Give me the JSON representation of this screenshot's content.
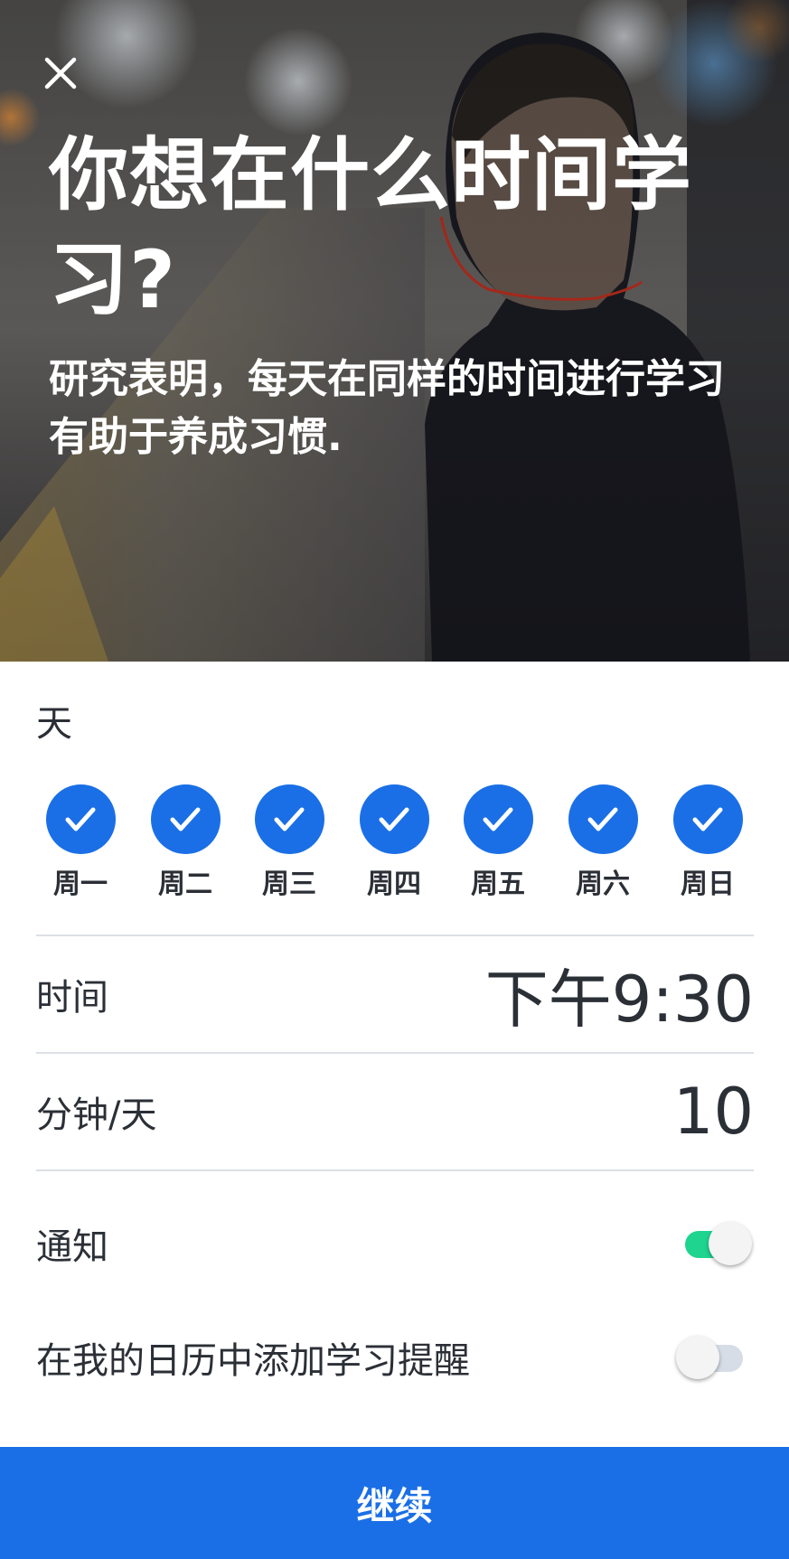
{
  "hero": {
    "close_icon": "close-icon",
    "title": "你想在什么时间学习?",
    "subtitle": "研究表明，每天在同样的时间进行学习有助于养成习惯."
  },
  "days_section": {
    "label": "天",
    "days": [
      {
        "label": "周一",
        "checked": true
      },
      {
        "label": "周二",
        "checked": true
      },
      {
        "label": "周三",
        "checked": true
      },
      {
        "label": "周四",
        "checked": true
      },
      {
        "label": "周五",
        "checked": true
      },
      {
        "label": "周六",
        "checked": true
      },
      {
        "label": "周日",
        "checked": true
      }
    ],
    "check_icon": "check-icon"
  },
  "time_row": {
    "label": "时间",
    "value": "下午9:30"
  },
  "minutes_row": {
    "label": "分钟/天",
    "value": "10"
  },
  "notify_row": {
    "label": "通知",
    "enabled": true
  },
  "calendar_row": {
    "label": "在我的日历中添加学习提醒",
    "enabled": false
  },
  "continue_button": {
    "label": "继续"
  },
  "colors": {
    "accent": "#1a6fe6",
    "toggle_on": "#1ed48f",
    "toggle_off": "#d6dde6",
    "divider": "#dcdfe4",
    "text": "#2b2f36"
  }
}
